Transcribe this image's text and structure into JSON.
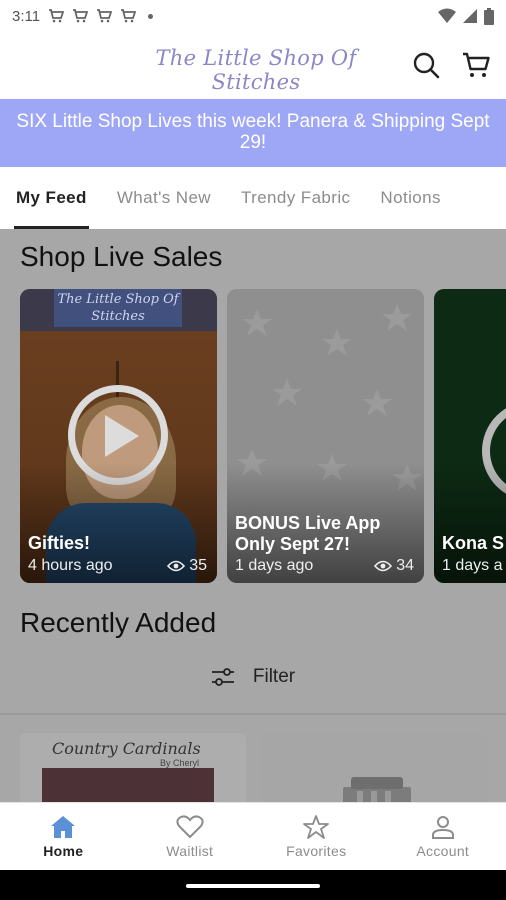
{
  "status_bar": {
    "time": "3:11",
    "notification_icons": [
      "cart-icon",
      "cart-icon",
      "cart-icon",
      "cart-icon",
      "dot-icon"
    ],
    "system_icons": [
      "wifi-icon",
      "signal-icon",
      "battery-icon"
    ]
  },
  "header": {
    "brand": "The Little Shop Of Stitches",
    "brand_color": "#8a86c8",
    "search_icon": "search-icon",
    "cart_icon": "cart-icon"
  },
  "announcement": {
    "text": "SIX Little Shop Lives this week!  Panera & Shipping Sept 29!",
    "background": "#9ea7f6"
  },
  "tabs": [
    {
      "label": "My Feed",
      "active": true
    },
    {
      "label": "What's New",
      "active": false
    },
    {
      "label": "Trendy Fabric",
      "active": false
    },
    {
      "label": "Notions",
      "active": false
    }
  ],
  "live_section": {
    "title": "Shop Live Sales",
    "cards": [
      {
        "title": "Gifties!",
        "time": "4 hours ago",
        "views": "35",
        "sign_text": "The Little Shop Of Stitches"
      },
      {
        "title": "BONUS Live App Only Sept 27!",
        "time": "1 days ago",
        "views": "34"
      },
      {
        "title": "Kona S",
        "time": "1 days a"
      }
    ]
  },
  "recent_section": {
    "title": "Recently Added",
    "filter_label": "Filter",
    "items": [
      {
        "title": "Country Cardinals",
        "subtitle": "By Cheryl"
      },
      {
        "title": ""
      }
    ]
  },
  "bottom_nav": [
    {
      "label": "Home",
      "icon": "home-icon",
      "active": true
    },
    {
      "label": "Waitlist",
      "icon": "heart-icon",
      "active": false
    },
    {
      "label": "Favorites",
      "icon": "star-icon",
      "active": false
    },
    {
      "label": "Account",
      "icon": "person-icon",
      "active": false
    }
  ]
}
